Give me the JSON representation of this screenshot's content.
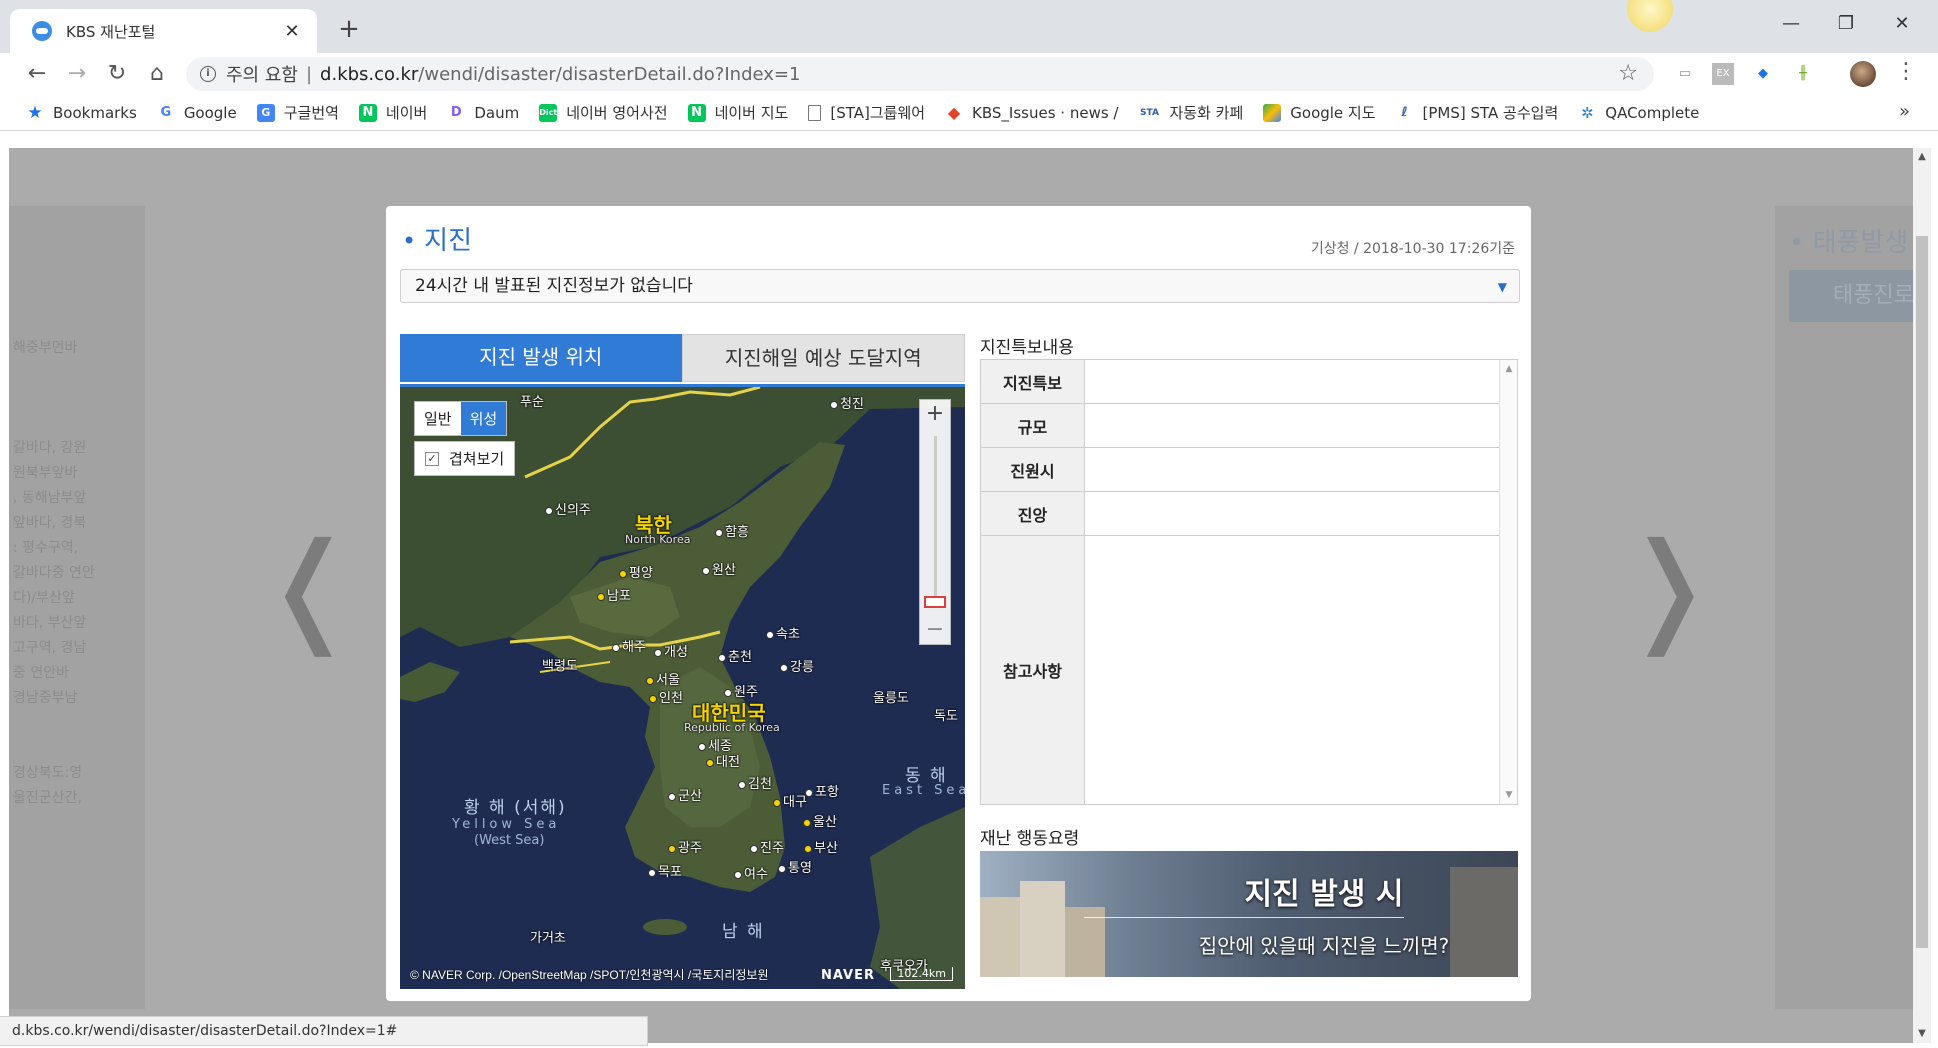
{
  "browser": {
    "tab_title": "KBS 재난포털",
    "security_label": "주의 요함",
    "separator": "|",
    "url_host": "d.kbs.co.kr",
    "url_path": "/wendi/disaster/disasterDetail.do?Index=1",
    "bookmarks": [
      {
        "label": "Bookmarks",
        "icon": "star-icon"
      },
      {
        "label": "Google",
        "icon": "google-icon"
      },
      {
        "label": "구글번역",
        "icon": "translate-icon"
      },
      {
        "label": "네이버",
        "icon": "naver-icon"
      },
      {
        "label": "Daum",
        "icon": "daum-icon"
      },
      {
        "label": "네이버 영어사전",
        "icon": "dictionary-icon"
      },
      {
        "label": "네이버 지도",
        "icon": "naver-icon"
      },
      {
        "label": "[STA]그룹웨어",
        "icon": "page-icon"
      },
      {
        "label": "KBS_Issues · news / ",
        "icon": "gitlab-icon"
      },
      {
        "label": "자동화 카페",
        "icon": "sta-icon"
      },
      {
        "label": "Google 지도",
        "icon": "google-maps-icon"
      },
      {
        "label": "[PMS] STA 공수입력",
        "icon": "pms-icon"
      },
      {
        "label": "QAComplete",
        "icon": "qacomplete-icon"
      }
    ],
    "bookmarks_more": "»",
    "status_url": "d.kbs.co.kr/wendi/disaster/disasterDetail.do?Index=1#"
  },
  "background": {
    "left_card_lines": [
      "해중부먼바",
      "",
      "",
      "",
      "갈바다, 강원",
      "원북부앞바",
      ", 동해남부앞",
      "앞바다, 경북",
      ": 평수구역,",
      "갈바다중 연안",
      "다)/부산앞",
      "바다, 부산앞",
      "고구역, 경남",
      "중 연안바",
      "경남중부남",
      "",
      "",
      "경상북도:영",
      "울진군산간,"
    ],
    "right_card_title": "• 태풍발생",
    "right_card_button": "태풍진로"
  },
  "modal": {
    "title": "지진",
    "source": "기상청 / 2018-10-30 17:26기준",
    "select_value": "24시간 내 발표된 지진정보가 없습니다",
    "tabs": [
      "지진 발생 위치",
      "지진해일 예상 도달지역"
    ],
    "map": {
      "type_buttons": [
        "일반",
        "위성"
      ],
      "active_type": "위성",
      "overlay_label": "겹쳐보기",
      "copyright": "© NAVER Corp. /OpenStreetMap /SPOT/인천광역시 /국토지리정보원",
      "logo": "NAVER",
      "scale": "102.4km",
      "labels": {
        "puseon": "푸순",
        "cheongjin": "청진",
        "sinuiju": "신의주",
        "north_korea": "북한",
        "north_korea_en": "North Korea",
        "hamheung": "함흥",
        "pyongyang": "평양",
        "wonsan": "원산",
        "nampo": "남포",
        "haeju": "해주",
        "kaesong": "개성",
        "sokcho": "속초",
        "baengnyeong": "백령도",
        "chuncheon": "춘천",
        "gangneung": "강릉",
        "seoul": "서울",
        "incheon": "인천",
        "wonju": "원주",
        "ulleung": "울릉도",
        "dokdo": "독도",
        "south_korea": "대한민국",
        "south_korea_en": "Republic of Korea",
        "sejong": "세종",
        "daejeon": "대전",
        "gimcheon": "김천",
        "gunsan": "군산",
        "pohang": "포항",
        "daegu": "대구",
        "ulsan": "울산",
        "east_sea": "동 해",
        "east_sea_en": "East Sea",
        "yellow_sea": "황 해 (서해)",
        "yellow_sea_en": "Yellow Sea",
        "yellow_sea_west": "(West Sea)",
        "gwangju": "광주",
        "jinju": "진주",
        "busan": "부산",
        "tongyeong": "통영",
        "mokpo": "목포",
        "yeosu": "여수",
        "south_sea": "남 해",
        "gageodo": "가거초",
        "fukuoka": "후쿠오카"
      }
    },
    "info_title": "지진특보내용",
    "info_rows": [
      {
        "label": "지진특보",
        "value": ""
      },
      {
        "label": "규모",
        "value": ""
      },
      {
        "label": "진원시",
        "value": ""
      },
      {
        "label": "진앙",
        "value": ""
      },
      {
        "label": "참고사항",
        "value": ""
      }
    ],
    "guide_title": "재난 행동요령",
    "guide_banner_title": "지진 발생 시",
    "guide_banner_sub": "집안에 있을때 지진을 느끼면?"
  }
}
